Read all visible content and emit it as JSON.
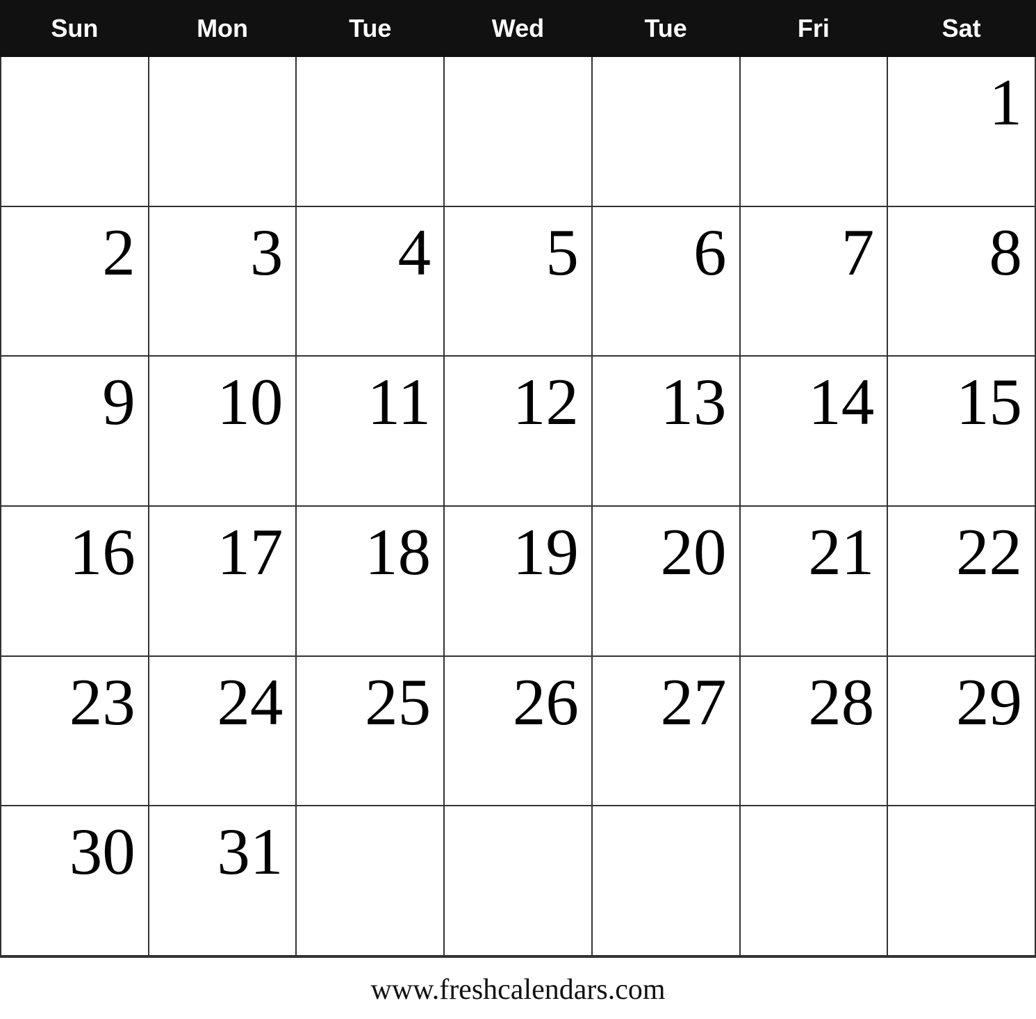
{
  "calendar": {
    "headers": [
      "Sun",
      "Mon",
      "Tue",
      "Wed",
      "Tue",
      "Fri",
      "Sat"
    ],
    "rows": [
      [
        null,
        null,
        null,
        null,
        null,
        null,
        1
      ],
      [
        2,
        3,
        4,
        5,
        6,
        7,
        8
      ],
      [
        9,
        10,
        11,
        12,
        13,
        14,
        15
      ],
      [
        16,
        17,
        18,
        19,
        20,
        21,
        22
      ],
      [
        23,
        24,
        25,
        26,
        27,
        28,
        29
      ],
      [
        30,
        31,
        null,
        null,
        null,
        null,
        null
      ]
    ]
  },
  "footer": {
    "url": "www.freshcalendars.com"
  }
}
